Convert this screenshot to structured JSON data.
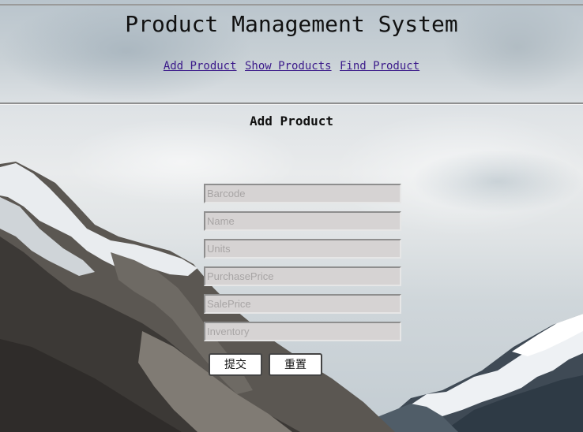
{
  "header": {
    "title": "Product Management System"
  },
  "nav": {
    "items": [
      {
        "label": "Add Product"
      },
      {
        "label": "Show Products"
      },
      {
        "label": "Find Product"
      }
    ]
  },
  "main": {
    "section_title": "Add Product",
    "form": {
      "fields": [
        {
          "placeholder": "Barcode",
          "value": ""
        },
        {
          "placeholder": "Name",
          "value": ""
        },
        {
          "placeholder": "Units",
          "value": ""
        },
        {
          "placeholder": "PurchasePrice",
          "value": ""
        },
        {
          "placeholder": "SalePrice",
          "value": ""
        },
        {
          "placeholder": "Inventory",
          "value": ""
        }
      ],
      "submit_label": "提交",
      "reset_label": "重置"
    }
  },
  "colors": {
    "link": "#3b1a8a",
    "input_bg": "#d6d3d3",
    "background_sky": "#dfe3e6"
  },
  "background": {
    "image": "mountain-landscape"
  }
}
